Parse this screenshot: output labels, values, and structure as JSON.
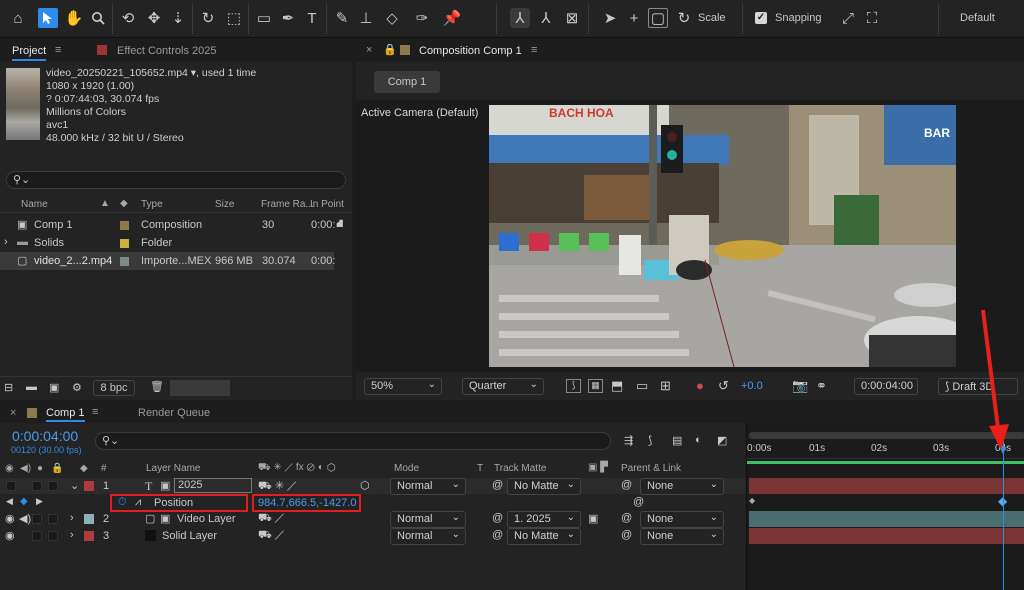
{
  "toolbar": {
    "scale_label": "Scale",
    "snapping_label": "Snapping",
    "workspace_label": "Default",
    "icons": [
      "home-icon",
      "selection-tool-icon",
      "hand-tool-icon",
      "zoom-tool-icon",
      "orbit-camera-icon",
      "pan-camera-icon",
      "dolly-camera-icon",
      "rotate-tool-icon",
      "pan-behind-icon",
      "rectangle-tool-icon",
      "pen-tool-icon",
      "type-tool-icon",
      "brush-tool-icon",
      "clone-stamp-icon",
      "eraser-icon",
      "roto-brush-icon",
      "puppet-pin-icon"
    ]
  },
  "project_panel": {
    "tab_project": "Project",
    "tab_effect_controls": "Effect Controls 2025",
    "footage": {
      "name": "video_20250221_105652.mp4",
      "used": ", used 1 time",
      "resolution": "1080 x 1920 (1.00)",
      "duration": "? 0:07:44:03, 30.074 fps",
      "colors": "Millions of Colors",
      "codec": "avc1",
      "audio": "48.000 kHz / 32 bit U / Stereo"
    },
    "search_placeholder": "",
    "columns": [
      "Name",
      "Type",
      "Size",
      "Frame Ra...",
      "In Point"
    ],
    "items": [
      {
        "name": "Comp 1",
        "type": "Composition",
        "size": "",
        "fps": "30",
        "in": "0:00:",
        "color": "#8b7a4a"
      },
      {
        "name": "Solids",
        "type": "Folder",
        "size": "",
        "fps": "",
        "in": "",
        "color": "#c8b43c"
      },
      {
        "name": "video_2...2.mp4",
        "type": "Importe...MEX",
        "size": "966 MB",
        "fps": "30.074",
        "in": "0:00:",
        "color": "#7f8a8a"
      }
    ],
    "bpc_label": "8 bpc"
  },
  "comp_panel": {
    "tab_label": "Composition Comp 1",
    "breadcrumb": "Comp 1",
    "camera_label": "Active Camera (Default)",
    "zoom": "50%",
    "resolution": "Quarter",
    "exposure": "+0.0",
    "timecode": "0:00:04:00",
    "draft": "Draft 3D"
  },
  "timeline": {
    "tab_comp": "Comp 1",
    "tab_render": "Render Queue",
    "timecode": "0:00:04:00",
    "frames": "00120 (30.00 fps)",
    "search_placeholder": "",
    "col_layer_name": "Layer Name",
    "col_mode": "Mode",
    "col_t": "T",
    "col_track_matte": "Track Matte",
    "col_parent": "Parent & Link",
    "ruler": [
      "0:00s",
      "01s",
      "02s",
      "03s",
      "04s"
    ],
    "layers": [
      {
        "num": "1",
        "name": "2025",
        "mode": "Normal",
        "matte": "No Matte",
        "parent": "None",
        "color": "#b33a3a"
      },
      {
        "num": "2",
        "name": "Video Layer",
        "mode": "Normal",
        "matte": "1. 2025",
        "parent": "None",
        "color": "#8ab0b8"
      },
      {
        "num": "3",
        "name": "Solid Layer",
        "mode": "Normal",
        "matte": "No Matte",
        "parent": "None",
        "color": "#b33a3a"
      }
    ],
    "position_label": "Position",
    "position_value": "984.7,666.5,-1427.0"
  },
  "colors": {
    "accent": "#2d8ceb",
    "highlight_box": "#e02020",
    "arrow": "#e8201a",
    "layer_bar_red": "#7a3434",
    "layer_bar_teal": "#4b6d6f"
  }
}
